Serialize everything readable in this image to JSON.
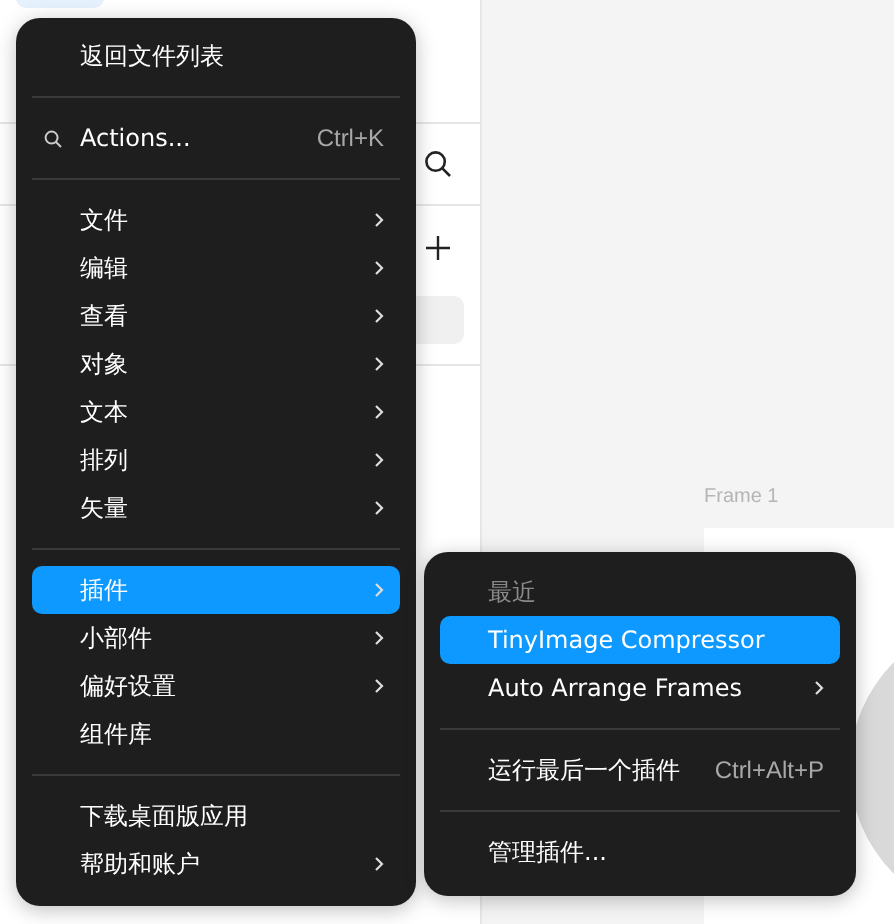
{
  "canvas": {
    "frame_label": "Frame 1"
  },
  "menu": {
    "items": [
      {
        "kind": "item",
        "label": "返回文件列表",
        "has_submenu": false,
        "selected": false
      },
      {
        "kind": "separator"
      },
      {
        "kind": "search",
        "label": "Actions...",
        "shortcut": "Ctrl+K",
        "has_submenu": false,
        "selected": false
      },
      {
        "kind": "separator"
      },
      {
        "kind": "item",
        "label": "文件",
        "has_submenu": true,
        "selected": false
      },
      {
        "kind": "item",
        "label": "编辑",
        "has_submenu": true,
        "selected": false
      },
      {
        "kind": "item",
        "label": "查看",
        "has_submenu": true,
        "selected": false
      },
      {
        "kind": "item",
        "label": "对象",
        "has_submenu": true,
        "selected": false
      },
      {
        "kind": "item",
        "label": "文本",
        "has_submenu": true,
        "selected": false
      },
      {
        "kind": "item",
        "label": "排列",
        "has_submenu": true,
        "selected": false
      },
      {
        "kind": "item",
        "label": "矢量",
        "has_submenu": true,
        "selected": false
      },
      {
        "kind": "separator"
      },
      {
        "kind": "item",
        "label": "插件",
        "has_submenu": true,
        "selected": true
      },
      {
        "kind": "item",
        "label": "小部件",
        "has_submenu": true,
        "selected": false
      },
      {
        "kind": "item",
        "label": "偏好设置",
        "has_submenu": true,
        "selected": false
      },
      {
        "kind": "item",
        "label": "组件库",
        "has_submenu": false,
        "selected": false
      },
      {
        "kind": "separator"
      },
      {
        "kind": "item",
        "label": "下载桌面版应用",
        "has_submenu": false,
        "selected": false
      },
      {
        "kind": "item",
        "label": "帮助和账户",
        "has_submenu": true,
        "selected": false
      }
    ]
  },
  "submenu": {
    "items": [
      {
        "kind": "header",
        "label": "最近"
      },
      {
        "kind": "item",
        "label": "TinyImage Compressor",
        "has_submenu": false,
        "selected": true
      },
      {
        "kind": "item",
        "label": "Auto Arrange Frames",
        "has_submenu": true,
        "selected": false
      },
      {
        "kind": "separator"
      },
      {
        "kind": "item",
        "label": "运行最后一个插件",
        "shortcut": "Ctrl+Alt+P",
        "has_submenu": false,
        "selected": false
      },
      {
        "kind": "separator"
      },
      {
        "kind": "item",
        "label": "管理插件...",
        "has_submenu": false,
        "selected": false
      }
    ]
  }
}
